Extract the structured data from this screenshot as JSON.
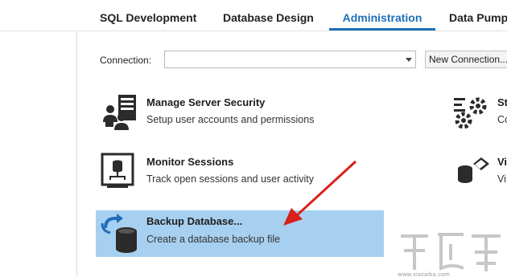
{
  "tabs": [
    {
      "label": "SQL Development"
    },
    {
      "label": "Database Design"
    },
    {
      "label": "Administration",
      "active": true
    },
    {
      "label": "Data Pump"
    }
  ],
  "connection": {
    "label": "Connection:",
    "value": "",
    "new_button": "New Connection..."
  },
  "tasks": [
    {
      "title": "Manage Server Security",
      "description": "Setup user accounts and permissions",
      "icon": "server-security-icon"
    },
    {
      "title": "Monitor Sessions",
      "description": "Track open sessions and user activity",
      "icon": "monitor-sessions-icon"
    },
    {
      "title": "Backup Database...",
      "description": "Create a database backup file",
      "icon": "backup-database-icon",
      "selected": true
    }
  ],
  "right_tasks": [
    {
      "title": "St",
      "description": "Co",
      "icon": "gears-icon"
    },
    {
      "title": "Vi",
      "description": "Vi",
      "icon": "database-eraser-icon"
    }
  ],
  "colors": {
    "accent": "#1f6fb8",
    "selection": "#a7d0f0",
    "annotation_arrow": "#d9201c"
  }
}
